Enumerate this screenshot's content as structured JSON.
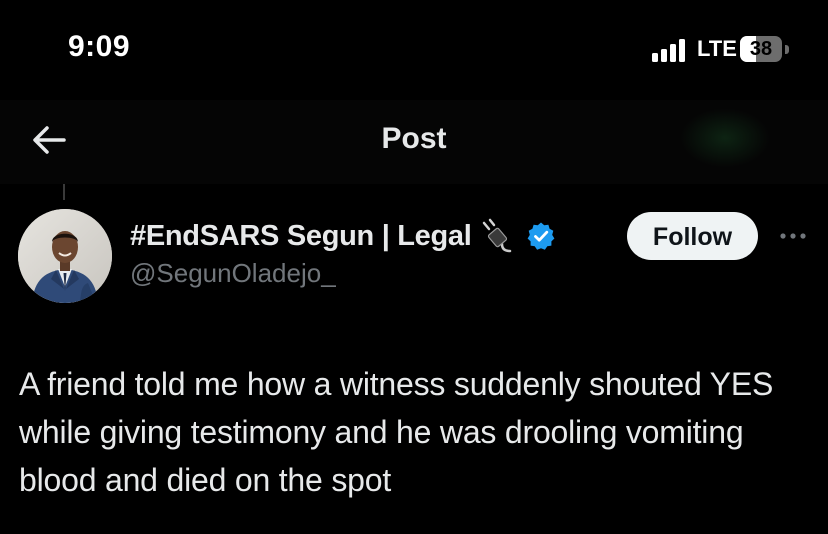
{
  "status_bar": {
    "time": "9:09",
    "network": "LTE",
    "battery_level": "38",
    "battery_percent": 38,
    "signal_bars_active": 4
  },
  "nav": {
    "back_icon": "arrow-left-icon",
    "title": "Post"
  },
  "post": {
    "author": {
      "display_name": "#EndSARS Segun | Legal",
      "handle": "@SegunOladejo_",
      "avatar_icon": "avatar-photo",
      "name_emoji_icon": "plug-icon",
      "verified_icon": "verified-badge-icon",
      "verified_color": "#1d9bf0"
    },
    "follow_label": "Follow",
    "more_icon": "more-options-icon",
    "text": "A friend told me how a witness suddenly shouted YES while giving testimony and he was drooling vomiting blood and died on the spot"
  },
  "colors": {
    "background": "#000000",
    "text_primary": "#e7e9ea",
    "text_secondary": "#71767b",
    "follow_button_bg": "#eff3f4"
  }
}
